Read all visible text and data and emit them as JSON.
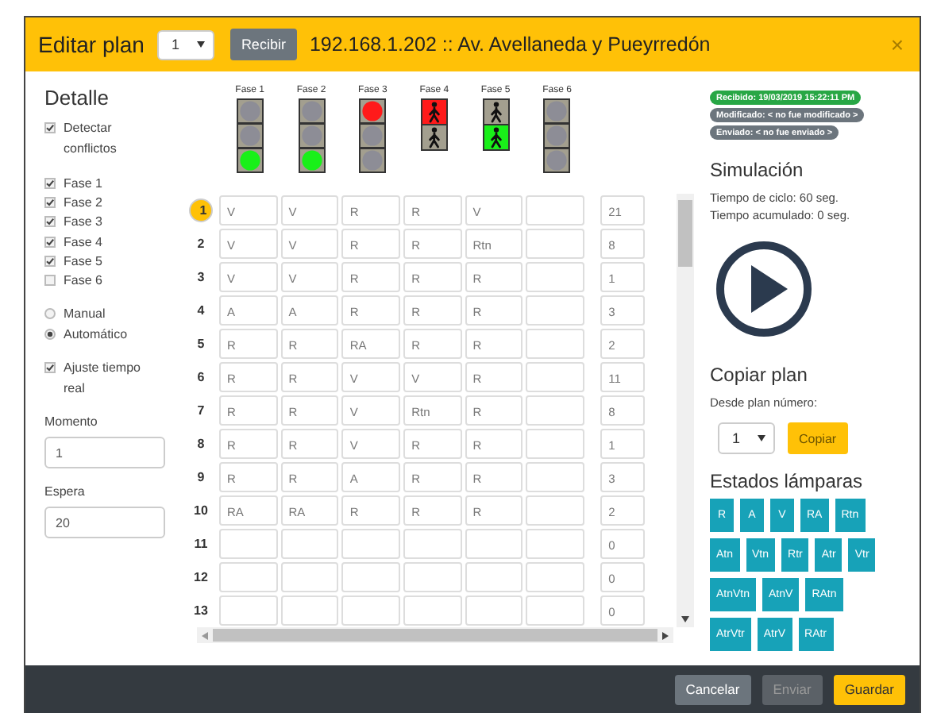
{
  "header": {
    "title": "Editar plan",
    "plan_select": "1",
    "receive_button": "Recibir",
    "address": "192.168.1.202 :: Av. Avellaneda y Pueyrredón",
    "close": "×"
  },
  "detail": {
    "heading": "Detalle",
    "conflicts": {
      "label": "Detectar conflictos",
      "checked": true
    },
    "phases": [
      {
        "label": "Fase 1",
        "checked": true
      },
      {
        "label": "Fase 2",
        "checked": true
      },
      {
        "label": "Fase 3",
        "checked": true
      },
      {
        "label": "Fase 4",
        "checked": true
      },
      {
        "label": "Fase 5",
        "checked": true
      },
      {
        "label": "Fase 6",
        "checked": false
      }
    ],
    "modes": [
      {
        "label": "Manual",
        "selected": false
      },
      {
        "label": "Automático",
        "selected": true
      }
    ],
    "realtime": {
      "label": "Ajuste tiempo real",
      "checked": true
    },
    "fields": [
      {
        "label": "Momento",
        "value": "1"
      },
      {
        "label": "Espera",
        "value": "20"
      }
    ]
  },
  "lights": [
    {
      "label": "Fase 1",
      "kind": "vehicle",
      "lamps": [
        {
          "on": false
        },
        {
          "on": false
        },
        {
          "on": true
        }
      ]
    },
    {
      "label": "Fase 2",
      "kind": "vehicle",
      "lamps": [
        {
          "on": false
        },
        {
          "on": false
        },
        {
          "on": true
        }
      ]
    },
    {
      "label": "Fase 3",
      "kind": "vehicle",
      "lamps": [
        {
          "on": true
        },
        {
          "on": false
        },
        {
          "on": false
        }
      ]
    },
    {
      "label": "Fase 4",
      "kind": "pedestrian",
      "lamps": [
        {
          "on": true
        },
        {
          "on": false
        }
      ]
    },
    {
      "label": "Fase 5",
      "kind": "pedestrian",
      "lamps": [
        {
          "on": false
        },
        {
          "on": true
        }
      ]
    },
    {
      "label": "Fase 6",
      "kind": "vehicle",
      "lamps": [
        {
          "on": false
        },
        {
          "on": false
        },
        {
          "on": false
        }
      ]
    }
  ],
  "table": {
    "rows": [
      {
        "number": "1",
        "selected": true,
        "cells": [
          "V",
          "V",
          "R",
          "R",
          "V",
          null
        ],
        "time": "21"
      },
      {
        "number": "2",
        "selected": false,
        "cells": [
          "V",
          "V",
          "R",
          "R",
          "Rtn",
          null
        ],
        "time": "8"
      },
      {
        "number": "3",
        "selected": false,
        "cells": [
          "V",
          "V",
          "R",
          "R",
          "R",
          null
        ],
        "time": "1"
      },
      {
        "number": "4",
        "selected": false,
        "cells": [
          "A",
          "A",
          "R",
          "R",
          "R",
          null
        ],
        "time": "3"
      },
      {
        "number": "5",
        "selected": false,
        "cells": [
          "R",
          "R",
          "RA",
          "R",
          "R",
          null
        ],
        "time": "2"
      },
      {
        "number": "6",
        "selected": false,
        "cells": [
          "R",
          "R",
          "V",
          "V",
          "R",
          null
        ],
        "time": "11"
      },
      {
        "number": "7",
        "selected": false,
        "cells": [
          "R",
          "R",
          "V",
          "Rtn",
          "R",
          null
        ],
        "time": "8"
      },
      {
        "number": "8",
        "selected": false,
        "cells": [
          "R",
          "R",
          "V",
          "R",
          "R",
          null
        ],
        "time": "1"
      },
      {
        "number": "9",
        "selected": false,
        "cells": [
          "R",
          "R",
          "A",
          "R",
          "R",
          null
        ],
        "time": "3"
      },
      {
        "number": "10",
        "selected": false,
        "cells": [
          "RA",
          "RA",
          "R",
          "R",
          "R",
          null
        ],
        "time": "2"
      },
      {
        "number": "11",
        "selected": false,
        "cells": [
          null,
          null,
          null,
          null,
          null,
          null
        ],
        "time": "0"
      },
      {
        "number": "12",
        "selected": false,
        "cells": [
          null,
          null,
          null,
          null,
          null,
          null
        ],
        "time": "0"
      },
      {
        "number": "13",
        "selected": false,
        "cells": [
          null,
          null,
          null,
          null,
          null,
          null
        ],
        "time": "0"
      }
    ]
  },
  "badges": [
    {
      "text": "Recibido: 19/03/2019 15:22:11 PM",
      "color": "#28a745"
    },
    {
      "text": "Modificado: < no fue modificado >",
      "color": "#6c757d"
    },
    {
      "text": "Enviado: < no fue enviado >",
      "color": "#6c757d"
    }
  ],
  "simulation": {
    "heading": "Simulación",
    "lines": [
      "Tiempo de ciclo: 60 seg.",
      "Tiempo acumulado: 0 seg."
    ]
  },
  "copy": {
    "heading": "Copiar plan",
    "label": "Desde plan número:",
    "select": "1",
    "button": "Copiar"
  },
  "lamp_states": {
    "heading": "Estados lámparas",
    "buttons": [
      "R",
      "A",
      "V",
      "RA",
      "Rtn",
      "Atn",
      "Vtn",
      "Rtr",
      "Atr",
      "Vtr",
      "AtnVtn",
      "AtnV",
      "RAtn",
      "AtrVtr",
      "AtrV",
      "RAtr"
    ]
  },
  "footer": [
    {
      "label": "Cancelar",
      "kind": "secondary"
    },
    {
      "label": "Enviar",
      "kind": "disabled"
    },
    {
      "label": "Guardar",
      "kind": "primary"
    }
  ]
}
